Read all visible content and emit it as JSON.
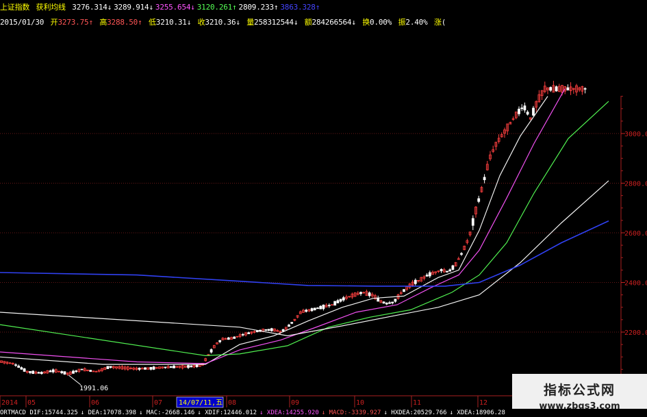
{
  "header": {
    "index_name": "上证指数",
    "indicator_name": "获利均线",
    "ma_values": [
      {
        "text": "3276.314↓",
        "color": "#ffffff"
      },
      {
        "text": "3289.914↓",
        "color": "#ffffff"
      },
      {
        "text": "3255.654↓",
        "color": "#ff55ff"
      },
      {
        "text": "3120.261↑",
        "color": "#55ff55"
      },
      {
        "text": "2809.233↑",
        "color": "#ffffff"
      },
      {
        "text": "3863.328↑",
        "color": "#4444ff"
      }
    ],
    "date": "2015/01/30",
    "open_label": "开",
    "open": "3273.75↑",
    "high_label": "高",
    "high": "3288.50↑",
    "low_label": "低",
    "low": "3210.31↓",
    "close_label": "收",
    "close": "3210.36↓",
    "volume_label": "量",
    "volume": "258312544↓",
    "amount_label": "额",
    "amount": "284266564↓",
    "turnover_label": "换",
    "turnover": "0.00%",
    "amplitude_label": "振",
    "amplitude": "2.40%",
    "change_label": "涨",
    "change": "("
  },
  "annotation": "1991.06",
  "date_tooltip": "14/07/11,五",
  "watermark": {
    "line1": "指标公式网",
    "line2": "www.zbgs3.com"
  },
  "bottom_bar": [
    {
      "text": "ORTMACD DIF:15744.325",
      "color": "#ffffff"
    },
    {
      "text": "↓ DEA:17078.398",
      "color": "#ffffff"
    },
    {
      "text": "↓ MAC:-2668.146",
      "color": "#ffffff"
    },
    {
      "text": "↓ XDIF:12446.012",
      "color": "#ffffff"
    },
    {
      "text": "↓ XDEA:14255.920",
      "color": "#ff55ff"
    },
    {
      "text": "↓ MACD:-3339.927",
      "color": "#ff5555"
    },
    {
      "text": "↓ HXDEA:20529.766",
      "color": "#ffffff"
    },
    {
      "text": "↓ XDEA:18906.28",
      "color": "#ffffff"
    }
  ],
  "chart_data": {
    "type": "line",
    "title": "",
    "x_ticks": [
      "2014",
      "05",
      "06",
      "07",
      "08",
      "09",
      "10",
      "11",
      "12"
    ],
    "y_ticks": [
      2200,
      2400,
      2600,
      2800,
      3000
    ],
    "ylim": [
      1980,
      3180
    ],
    "grid": "horizontal dotted at y ticks",
    "colors": {
      "up": "#ff4040",
      "down": "#ffffff",
      "ma_fast": "#ffffff",
      "ma_mid": "#ff55ff",
      "ma_slow": "#55ff55",
      "ma_long": "#ffffff",
      "ma_yearly": "#3344ff"
    },
    "close_series": [
      [
        0,
        2082
      ],
      [
        20,
        2072
      ],
      [
        40,
        2040
      ],
      [
        60,
        2035
      ],
      [
        80,
        2045
      ],
      [
        100,
        2032
      ],
      [
        120,
        2050
      ],
      [
        140,
        2040
      ],
      [
        160,
        2060
      ],
      [
        180,
        2056
      ],
      [
        200,
        2052
      ],
      [
        220,
        2054
      ],
      [
        240,
        2058
      ],
      [
        260,
        2060
      ],
      [
        280,
        2062
      ],
      [
        295,
        2066
      ],
      [
        305,
        2110
      ],
      [
        315,
        2150
      ],
      [
        325,
        2172
      ],
      [
        340,
        2175
      ],
      [
        355,
        2190
      ],
      [
        370,
        2200
      ],
      [
        385,
        2208
      ],
      [
        400,
        2210
      ],
      [
        410,
        2200
      ],
      [
        420,
        2220
      ],
      [
        430,
        2248
      ],
      [
        440,
        2282
      ],
      [
        455,
        2290
      ],
      [
        470,
        2300
      ],
      [
        485,
        2310
      ],
      [
        500,
        2332
      ],
      [
        515,
        2348
      ],
      [
        530,
        2360
      ],
      [
        545,
        2348
      ],
      [
        555,
        2324
      ],
      [
        565,
        2315
      ],
      [
        575,
        2320
      ],
      [
        585,
        2355
      ],
      [
        595,
        2380
      ],
      [
        605,
        2400
      ],
      [
        615,
        2412
      ],
      [
        625,
        2430
      ],
      [
        635,
        2440
      ],
      [
        645,
        2450
      ],
      [
        655,
        2442
      ],
      [
        665,
        2470
      ],
      [
        675,
        2520
      ],
      [
        685,
        2580
      ],
      [
        695,
        2690
      ],
      [
        705,
        2790
      ],
      [
        715,
        2900
      ],
      [
        725,
        2960
      ],
      [
        735,
        3000
      ],
      [
        745,
        3040
      ],
      [
        755,
        3080
      ],
      [
        765,
        3110
      ],
      [
        775,
        3060
      ],
      [
        785,
        3130
      ],
      [
        795,
        3180
      ]
    ],
    "moving_averages": [
      {
        "points": [
          [
            0,
            2100
          ],
          [
            150,
            2070
          ],
          [
            300,
            2070
          ],
          [
            350,
            2150
          ],
          [
            400,
            2185
          ],
          [
            450,
            2245
          ],
          [
            500,
            2300
          ],
          [
            545,
            2336
          ],
          [
            590,
            2345
          ],
          [
            640,
            2420
          ],
          [
            670,
            2450
          ],
          [
            700,
            2610
          ],
          [
            730,
            2830
          ],
          [
            760,
            2990
          ],
          [
            800,
            3150
          ]
        ]
      },
      {
        "points": [
          [
            0,
            2120
          ],
          [
            200,
            2080
          ],
          [
            300,
            2073
          ],
          [
            350,
            2128
          ],
          [
            410,
            2168
          ],
          [
            460,
            2218
          ],
          [
            520,
            2280
          ],
          [
            580,
            2310
          ],
          [
            630,
            2380
          ],
          [
            670,
            2430
          ],
          [
            700,
            2530
          ],
          [
            740,
            2740
          ],
          [
            780,
            2960
          ],
          [
            825,
            3180
          ]
        ]
      },
      {
        "points": [
          [
            0,
            2230
          ],
          [
            300,
            2105
          ],
          [
            350,
            2112
          ],
          [
            420,
            2145
          ],
          [
            480,
            2220
          ],
          [
            540,
            2260
          ],
          [
            600,
            2290
          ],
          [
            660,
            2360
          ],
          [
            700,
            2430
          ],
          [
            740,
            2560
          ],
          [
            780,
            2760
          ],
          [
            830,
            2980
          ],
          [
            889,
            3130
          ]
        ]
      },
      {
        "points": [
          [
            0,
            2280
          ],
          [
            350,
            2220
          ],
          [
            420,
            2185
          ],
          [
            500,
            2225
          ],
          [
            580,
            2268
          ],
          [
            640,
            2300
          ],
          [
            700,
            2350
          ],
          [
            760,
            2480
          ],
          [
            820,
            2640
          ],
          [
            889,
            2810
          ]
        ]
      },
      {
        "points": [
          [
            0,
            2440
          ],
          [
            200,
            2430
          ],
          [
            350,
            2405
          ],
          [
            450,
            2388
          ],
          [
            550,
            2385
          ],
          [
            650,
            2385
          ],
          [
            700,
            2400
          ],
          [
            760,
            2470
          ],
          [
            820,
            2560
          ],
          [
            889,
            2648
          ]
        ]
      }
    ]
  },
  "annotation_point": {
    "x": 100,
    "price": 2038
  }
}
